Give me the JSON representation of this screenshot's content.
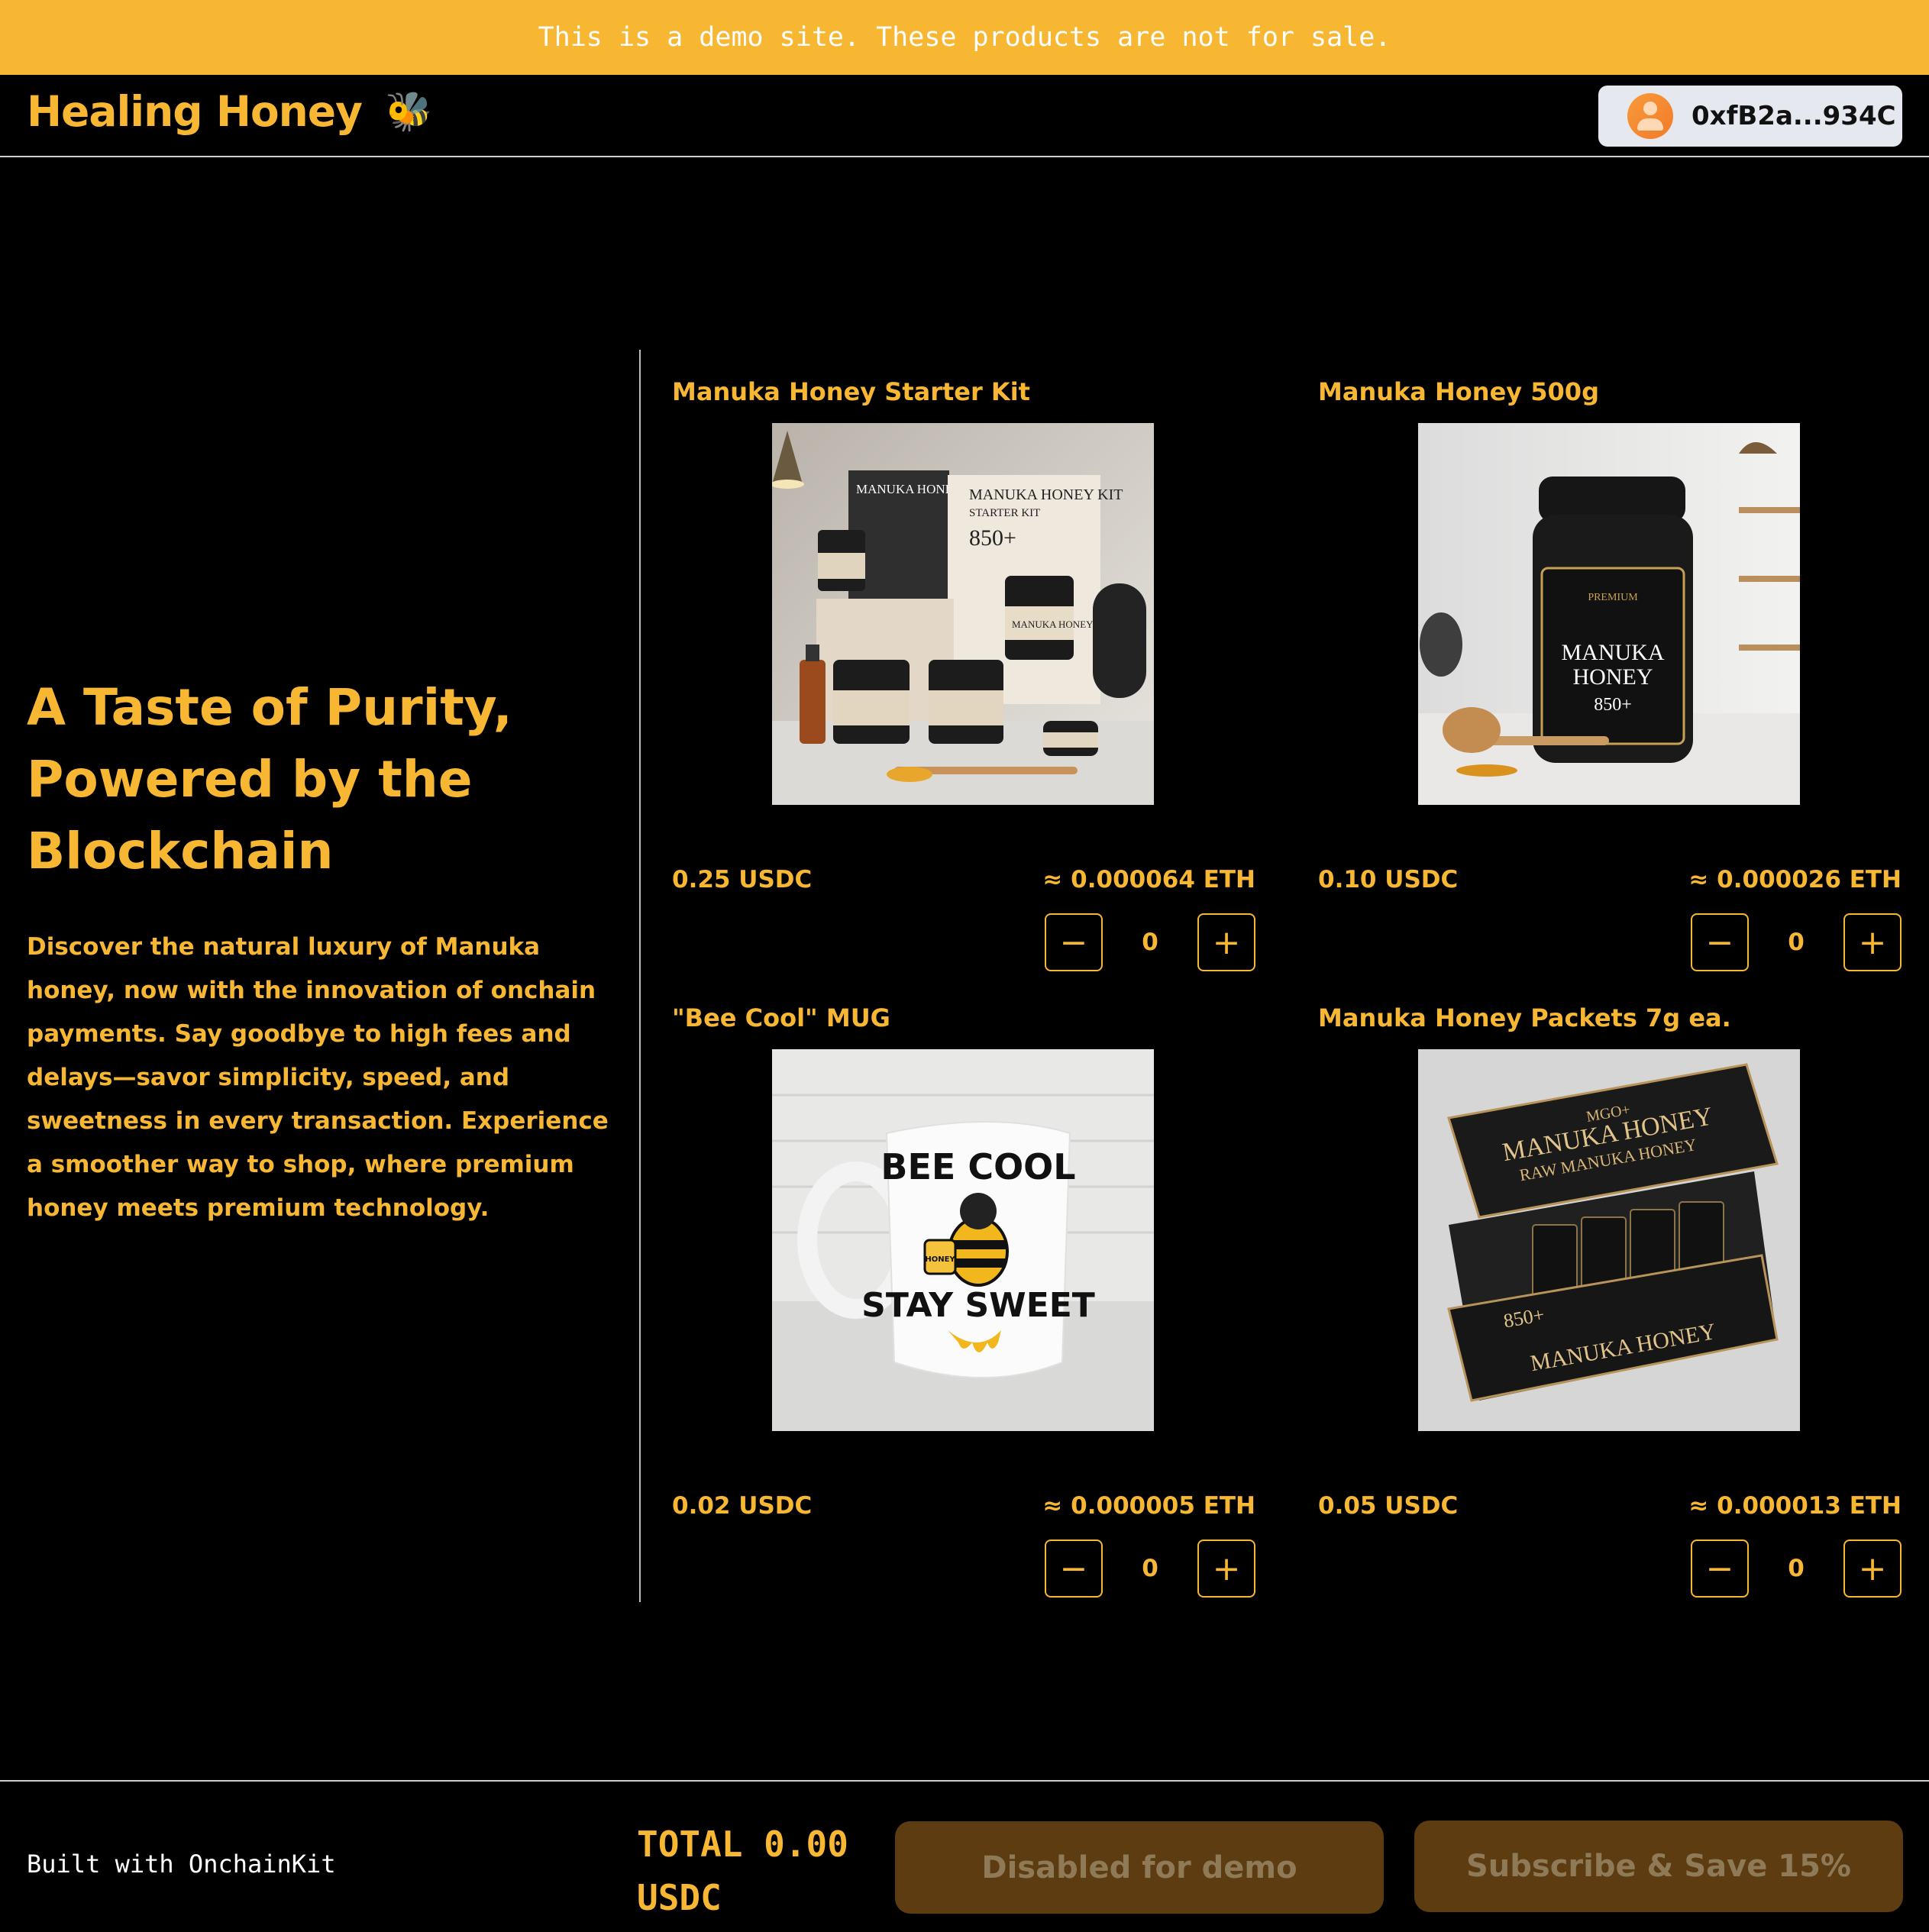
{
  "banner": {
    "text": "This is a demo site. These products are not for sale."
  },
  "header": {
    "brand": "Healing Honey",
    "brand_emoji": "🐝",
    "wallet_address": "0xfB2a...934C"
  },
  "hero": {
    "title_lines": [
      "A Taste of Purity,",
      "Powered by the",
      "Blockchain"
    ],
    "description": "Discover the natural luxury of Manuka honey, now with the innovation of onchain payments. Say goodbye to high fees and delays—savor simplicity, speed, and sweetness in every transaction. Experience a smoother way to shop, where premium honey meets premium technology."
  },
  "products": [
    {
      "name": "Manuka Honey Starter Kit",
      "price_usdc": "0.25 USDC",
      "price_eth": "≈ 0.000064 ETH",
      "quantity": "0"
    },
    {
      "name": "Manuka Honey 500g",
      "price_usdc": "0.10 USDC",
      "price_eth": "≈ 0.000026 ETH",
      "quantity": "0"
    },
    {
      "name": "\"Bee Cool\" MUG",
      "price_usdc": "0.02 USDC",
      "price_eth": "≈ 0.000005 ETH",
      "quantity": "0"
    },
    {
      "name": "Manuka Honey Packets 7g ea.",
      "price_usdc": "0.05 USDC",
      "price_eth": "≈ 0.000013 ETH",
      "quantity": "0"
    }
  ],
  "images": {
    "kit": {
      "box1": "MANUKA HONEY 850+",
      "box2": "MANUKA HONEY KIT",
      "box2_sub": "STARTER KIT",
      "box2_grade": "850+",
      "jar": "MANUKA HONEY"
    },
    "jar500": {
      "top": "PREMIUM",
      "line1": "MANUKA",
      "line2": "HONEY",
      "grade": "850+"
    },
    "mug": {
      "line1": "BEE COOL",
      "line2": "STAY SWEET",
      "jar": "HONEY"
    },
    "packets": {
      "line1": "MGO+",
      "line2": "MANUKA HONEY",
      "line3": "RAW MANUKA HONEY",
      "grade": "850+"
    }
  },
  "footer": {
    "built_with": "Built with OnchainKit",
    "total_line1": "TOTAL 0.00",
    "total_line2": "USDC",
    "checkout_label": "Disabled for demo",
    "subscribe_label": "Subscribe & Save 15%"
  },
  "colors": {
    "accent": "#f7b733",
    "background": "#000000",
    "button_disabled": "#5c3c10"
  }
}
